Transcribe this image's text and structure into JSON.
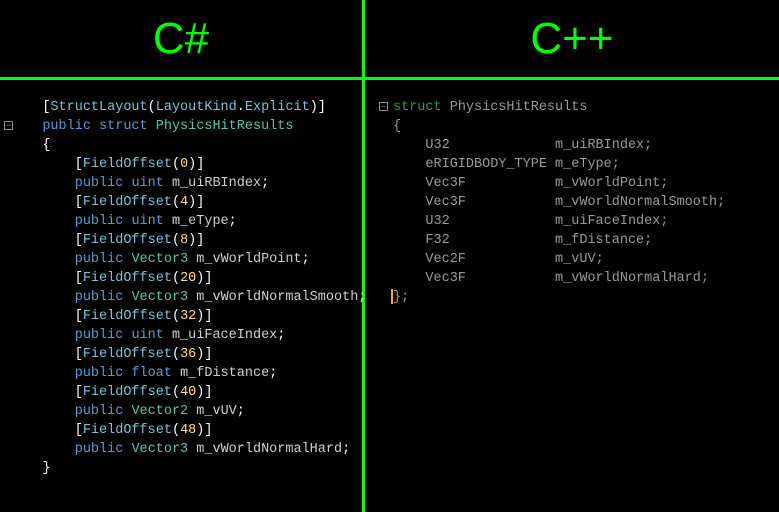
{
  "headers": {
    "left": "C#",
    "right": "C++"
  },
  "csharp": {
    "attr_struct": "StructLayout",
    "attr_struct_arg": "LayoutKind",
    "attr_struct_arg2": "Explicit",
    "kw_public": "public",
    "kw_struct": "struct",
    "struct_name": "PhysicsHitResults",
    "field_offset": "FieldOffset",
    "members": [
      {
        "offset": "0",
        "type": "uint",
        "name": "m_uiRBIndex"
      },
      {
        "offset": "4",
        "type": "uint",
        "name": "m_eType"
      },
      {
        "offset": "8",
        "type": "Vector3",
        "name": "m_vWorldPoint"
      },
      {
        "offset": "20",
        "type": "Vector3",
        "name": "m_vWorldNormalSmooth"
      },
      {
        "offset": "32",
        "type": "uint",
        "name": "m_uiFaceIndex"
      },
      {
        "offset": "36",
        "type": "float",
        "name": "m_fDistance"
      },
      {
        "offset": "40",
        "type": "Vector2",
        "name": "m_vUV"
      },
      {
        "offset": "48",
        "type": "Vector3",
        "name": "m_vWorldNormalHard"
      }
    ]
  },
  "cpp": {
    "kw_struct": "struct",
    "struct_name": "PhysicsHitResults",
    "members": [
      {
        "type": "U32",
        "name": "m_uiRBIndex"
      },
      {
        "type": "eRIGIDBODY_TYPE",
        "name": "m_eType"
      },
      {
        "type": "Vec3F",
        "name": "m_vWorldPoint"
      },
      {
        "type": "Vec3F",
        "name": "m_vWorldNormalSmooth"
      },
      {
        "type": "U32",
        "name": "m_uiFaceIndex"
      },
      {
        "type": "F32",
        "name": "m_fDistance"
      },
      {
        "type": "Vec2F",
        "name": "m_vUV"
      },
      {
        "type": "Vec3F",
        "name": "m_vWorldNormalHard"
      }
    ]
  }
}
